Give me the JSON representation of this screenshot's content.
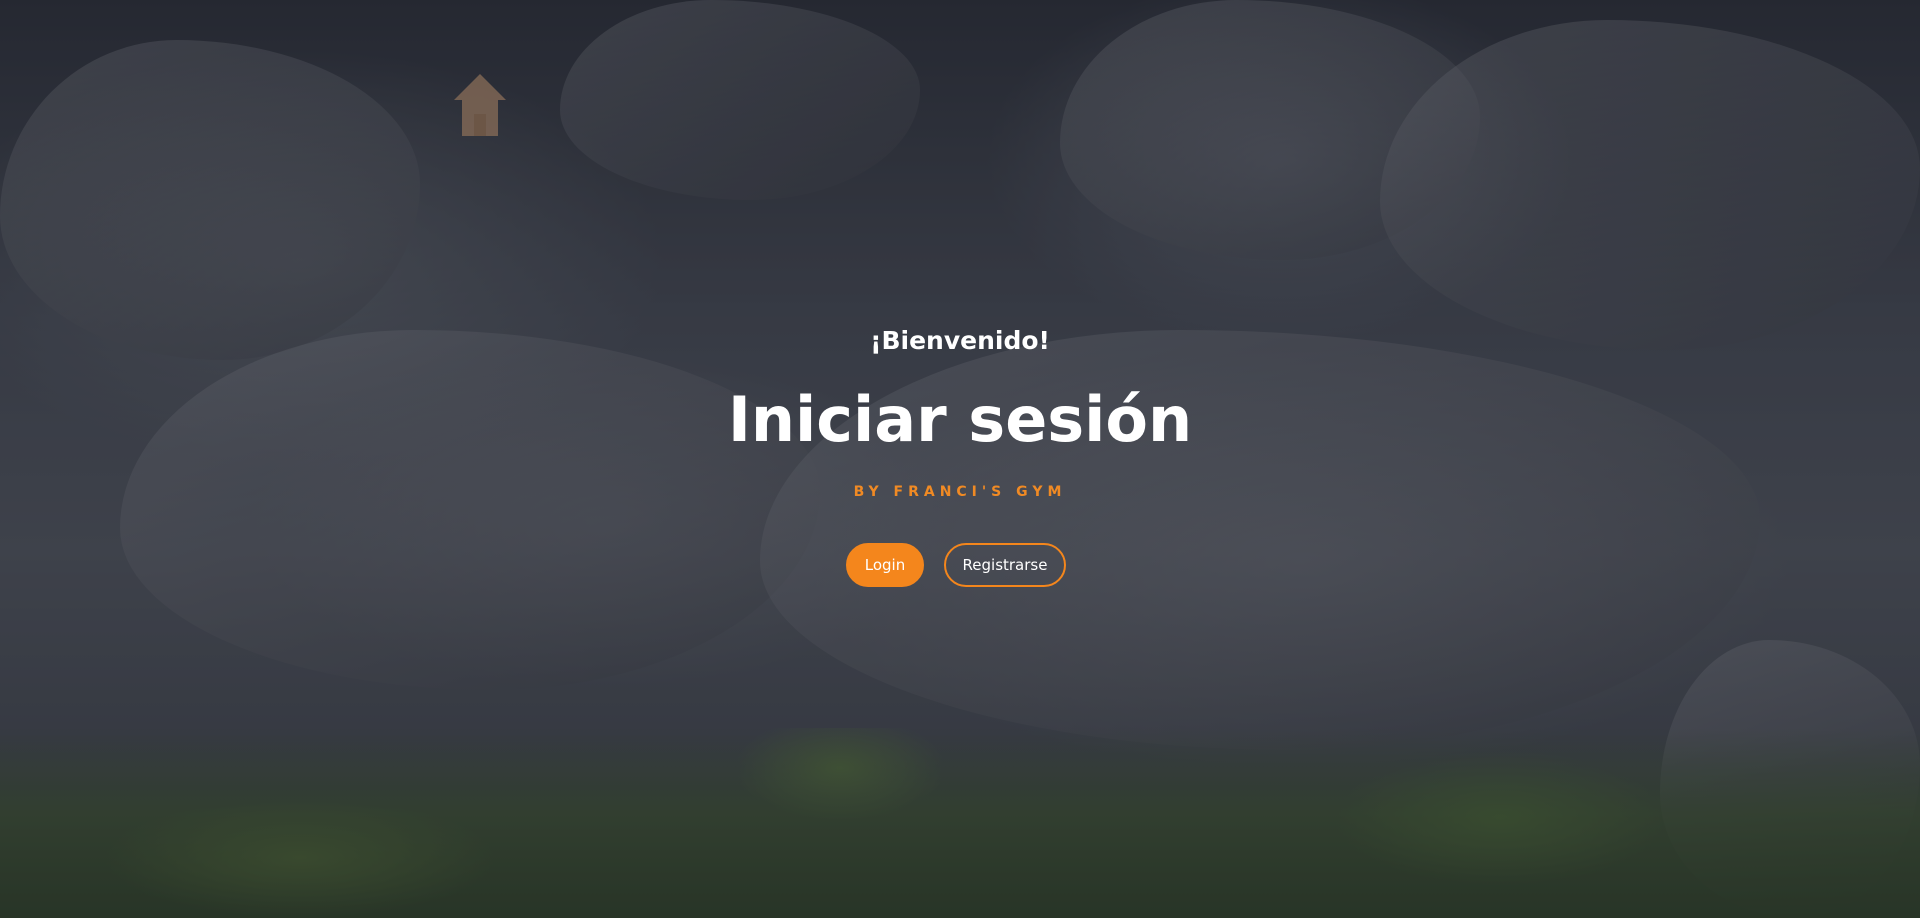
{
  "hero": {
    "welcome": "¡Bienvenido!",
    "title": "Iniciar sesión",
    "byline": "BY FRANCI'S GYM"
  },
  "nav": {
    "home_icon": "home-icon"
  },
  "actions": {
    "login_label": "Login",
    "register_label": "Registrarse"
  },
  "colors": {
    "accent": "#f4861c",
    "text": "#ffffff",
    "overlay": "#141822"
  }
}
